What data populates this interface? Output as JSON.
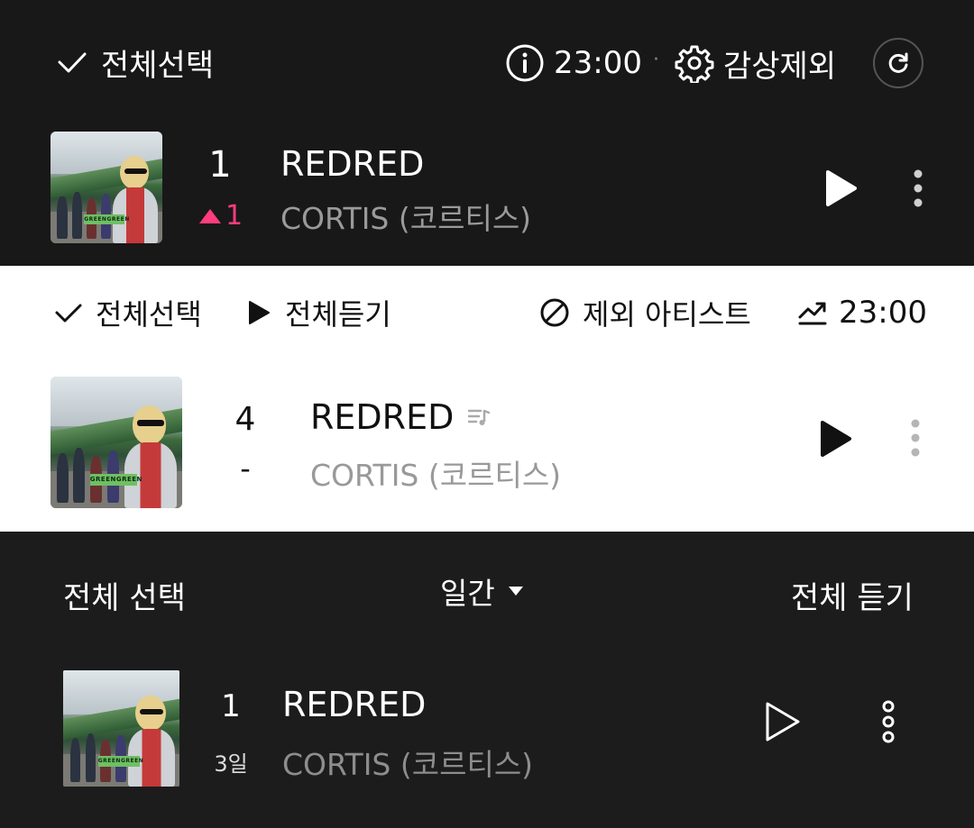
{
  "section1": {
    "select_all": "전체선택",
    "time": "23:00",
    "separator": "·",
    "exclude_label": "감상제외",
    "track": {
      "rank": "1",
      "change": "1",
      "title": "REDRED",
      "artist": "CORTIS (코르티스)",
      "album_label": "GREENGREEN"
    },
    "colors": {
      "up_arrow": "#ff3d7f"
    }
  },
  "section2": {
    "select_all": "전체선택",
    "play_all": "전체듣기",
    "exclude_artist": "제외 아티스트",
    "time": "23:00",
    "track": {
      "rank": "4",
      "change": "-",
      "title": "REDRED",
      "artist": "CORTIS (코르티스)",
      "album_label": "GREENGREEN"
    }
  },
  "section3": {
    "select_all": "전체 선택",
    "period": "일간",
    "play_all": "전체 듣기",
    "track": {
      "rank": "1",
      "days": "3일",
      "title": "REDRED",
      "artist": "CORTIS (코르티스)",
      "album_label": "GREENGREEN"
    }
  }
}
